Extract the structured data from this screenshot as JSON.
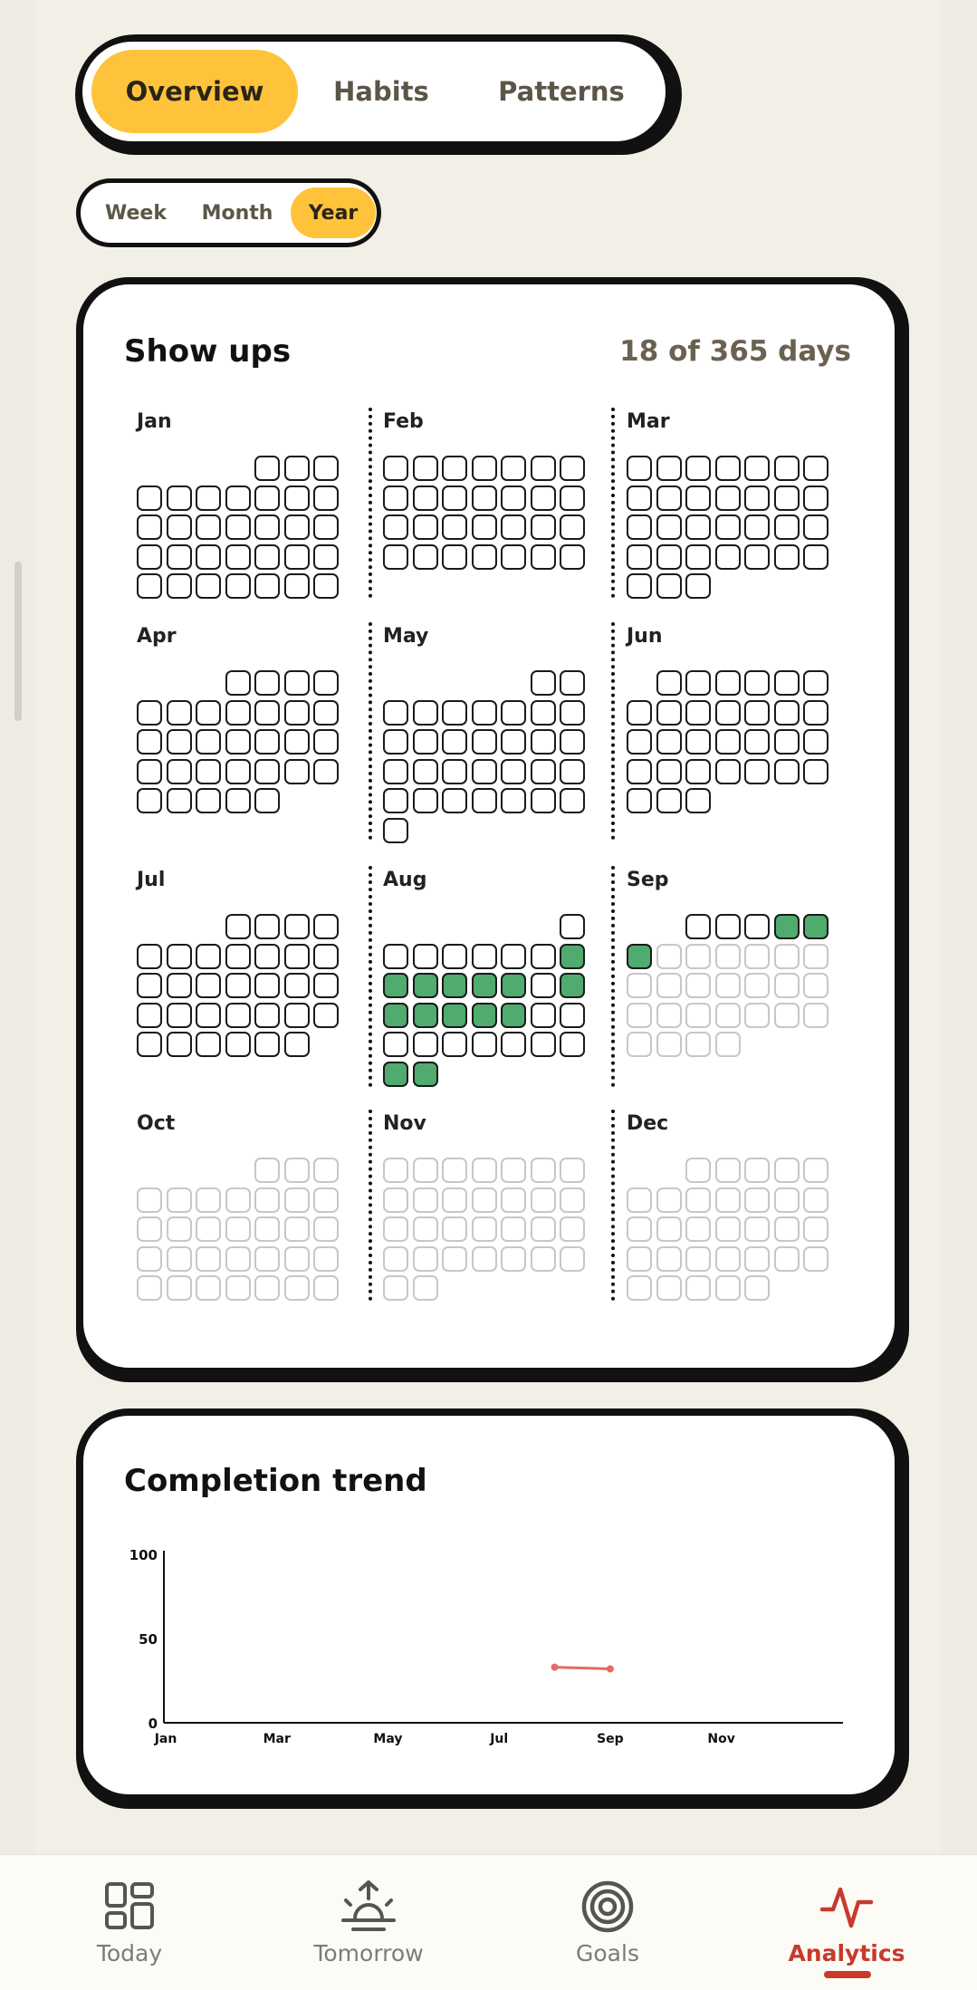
{
  "tabs": [
    {
      "id": "overview",
      "label": "Overview",
      "active": true
    },
    {
      "id": "habits",
      "label": "Habits",
      "active": false
    },
    {
      "id": "patterns",
      "label": "Patterns",
      "active": false
    }
  ],
  "period_tabs": [
    {
      "id": "week",
      "label": "Week",
      "active": false
    },
    {
      "id": "month",
      "label": "Month",
      "active": false
    },
    {
      "id": "year",
      "label": "Year",
      "active": true
    }
  ],
  "showups": {
    "title": "Show ups",
    "summary": "18 of 365 days",
    "months": [
      {
        "label": "Jan",
        "offset": 4,
        "days": 31,
        "done": [],
        "future": false,
        "partial_from": null
      },
      {
        "label": "Feb",
        "offset": 0,
        "days": 28,
        "done": [],
        "future": false,
        "partial_from": null
      },
      {
        "label": "Mar",
        "offset": 0,
        "days": 31,
        "done": [],
        "future": false,
        "partial_from": null
      },
      {
        "label": "Apr",
        "offset": 3,
        "days": 30,
        "done": [],
        "future": false,
        "partial_from": null
      },
      {
        "label": "May",
        "offset": 5,
        "days": 31,
        "done": [],
        "future": false,
        "partial_from": null
      },
      {
        "label": "Jun",
        "offset": 1,
        "days": 30,
        "done": [],
        "future": false,
        "partial_from": null
      },
      {
        "label": "Jul",
        "offset": 3,
        "days": 31,
        "done": [],
        "future": false,
        "partial_from": null
      },
      {
        "label": "Aug",
        "offset": 6,
        "days": 31,
        "done": [
          8,
          9,
          10,
          11,
          12,
          13,
          15,
          16,
          17,
          18,
          19,
          20,
          30,
          31
        ],
        "future": false,
        "partial_from": null
      },
      {
        "label": "Sep",
        "offset": 2,
        "days": 30,
        "done": [
          4,
          5,
          6
        ],
        "future": false,
        "partial_from": 7
      },
      {
        "label": "Oct",
        "offset": 4,
        "days": 31,
        "done": [],
        "future": true,
        "partial_from": null
      },
      {
        "label": "Nov",
        "offset": 0,
        "days": 30,
        "done": [],
        "future": true,
        "partial_from": null
      },
      {
        "label": "Dec",
        "offset": 2,
        "days": 31,
        "done": [],
        "future": true,
        "partial_from": null
      }
    ]
  },
  "trend": {
    "title": "Completion trend"
  },
  "chart_data": {
    "type": "line",
    "title": "Completion trend",
    "xlabel": "",
    "ylabel": "",
    "x_ticks": [
      "Jan",
      "Mar",
      "May",
      "Jul",
      "Sep",
      "Nov"
    ],
    "y_ticks": [
      0,
      50,
      100
    ],
    "ylim": [
      0,
      100
    ],
    "xlim": [
      1,
      12
    ],
    "series": [
      {
        "x": [
          8,
          9
        ],
        "y": [
          33,
          32
        ],
        "color": "#e46a66"
      }
    ],
    "grid": false
  },
  "nav": [
    {
      "id": "today",
      "label": "Today",
      "icon": "grid-icon",
      "active": false
    },
    {
      "id": "tomorrow",
      "label": "Tomorrow",
      "icon": "sunrise-icon",
      "active": false
    },
    {
      "id": "goals",
      "label": "Goals",
      "icon": "target-icon",
      "active": false
    },
    {
      "id": "analytics",
      "label": "Analytics",
      "icon": "pulse-icon",
      "active": true
    }
  ],
  "colors": {
    "accent": "#fec33a",
    "done": "#4fab6e",
    "nav_active": "#c73a2c",
    "trend_line": "#e46a66"
  }
}
